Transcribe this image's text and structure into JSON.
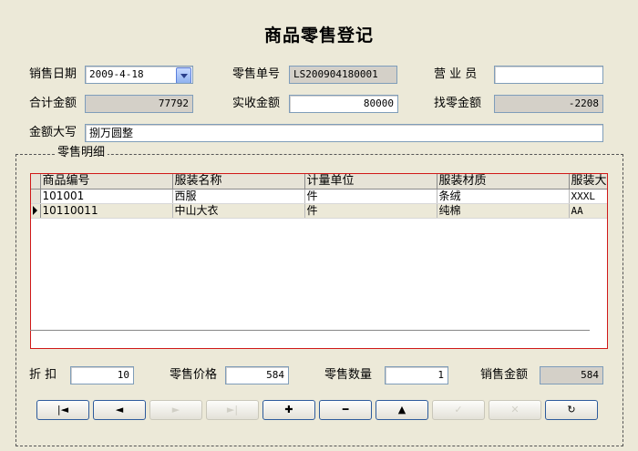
{
  "form": {
    "title": "商品零售登记"
  },
  "header": {
    "sale_date_label": "销售日期",
    "sale_date_value": "2009-4-18",
    "sale_no_label": "零售单号",
    "sale_no_value": "LS200904180001",
    "clerk_label": "营 业 员",
    "clerk_value": "",
    "total_label": "合计金额",
    "total_value": "77792",
    "received_label": "实收金额",
    "received_value": "80000",
    "change_label": "找零金额",
    "change_value": "-2208",
    "amount_words_label": "金额大写",
    "amount_words_value": "捌万圆整"
  },
  "detail": {
    "group_title": "零售明细",
    "columns": [
      "商品编号",
      "服装名称",
      "计量单位",
      "服装材质",
      "服装大"
    ],
    "rows": [
      {
        "code": "101001",
        "name": "西服",
        "unit": "件",
        "material": "条绒",
        "size": "XXXL",
        "selected": false
      },
      {
        "code": "10110011",
        "name": "中山大衣",
        "unit": "件",
        "material": "纯棉",
        "size": "AA",
        "selected": true
      }
    ]
  },
  "footer": {
    "discount_label": "折 扣",
    "discount_value": "10",
    "price_label": "零售价格",
    "price_value": "584",
    "qty_label": "零售数量",
    "qty_value": "1",
    "amount_label": "销售金额",
    "amount_value": "584"
  },
  "navigator": [
    {
      "name": "nav-first-button",
      "icon": "first-record-icon",
      "glyph": "|◄",
      "enabled": true
    },
    {
      "name": "nav-prior-button",
      "icon": "prior-record-icon",
      "glyph": "◄",
      "enabled": true
    },
    {
      "name": "nav-next-button",
      "icon": "next-record-icon",
      "glyph": "►",
      "enabled": false
    },
    {
      "name": "nav-last-button",
      "icon": "last-record-icon",
      "glyph": "►|",
      "enabled": false
    },
    {
      "name": "nav-insert-button",
      "icon": "plus-icon",
      "glyph": "✚",
      "enabled": true
    },
    {
      "name": "nav-delete-button",
      "icon": "minus-icon",
      "glyph": "━",
      "enabled": true
    },
    {
      "name": "nav-edit-button",
      "icon": "up-triangle-icon",
      "glyph": "▲",
      "enabled": true
    },
    {
      "name": "nav-post-button",
      "icon": "check-icon",
      "glyph": "✓",
      "enabled": false
    },
    {
      "name": "nav-cancel-button",
      "icon": "x-icon",
      "glyph": "✕",
      "enabled": false
    },
    {
      "name": "nav-refresh-button",
      "icon": "refresh-icon",
      "glyph": "↻",
      "enabled": true
    }
  ]
}
